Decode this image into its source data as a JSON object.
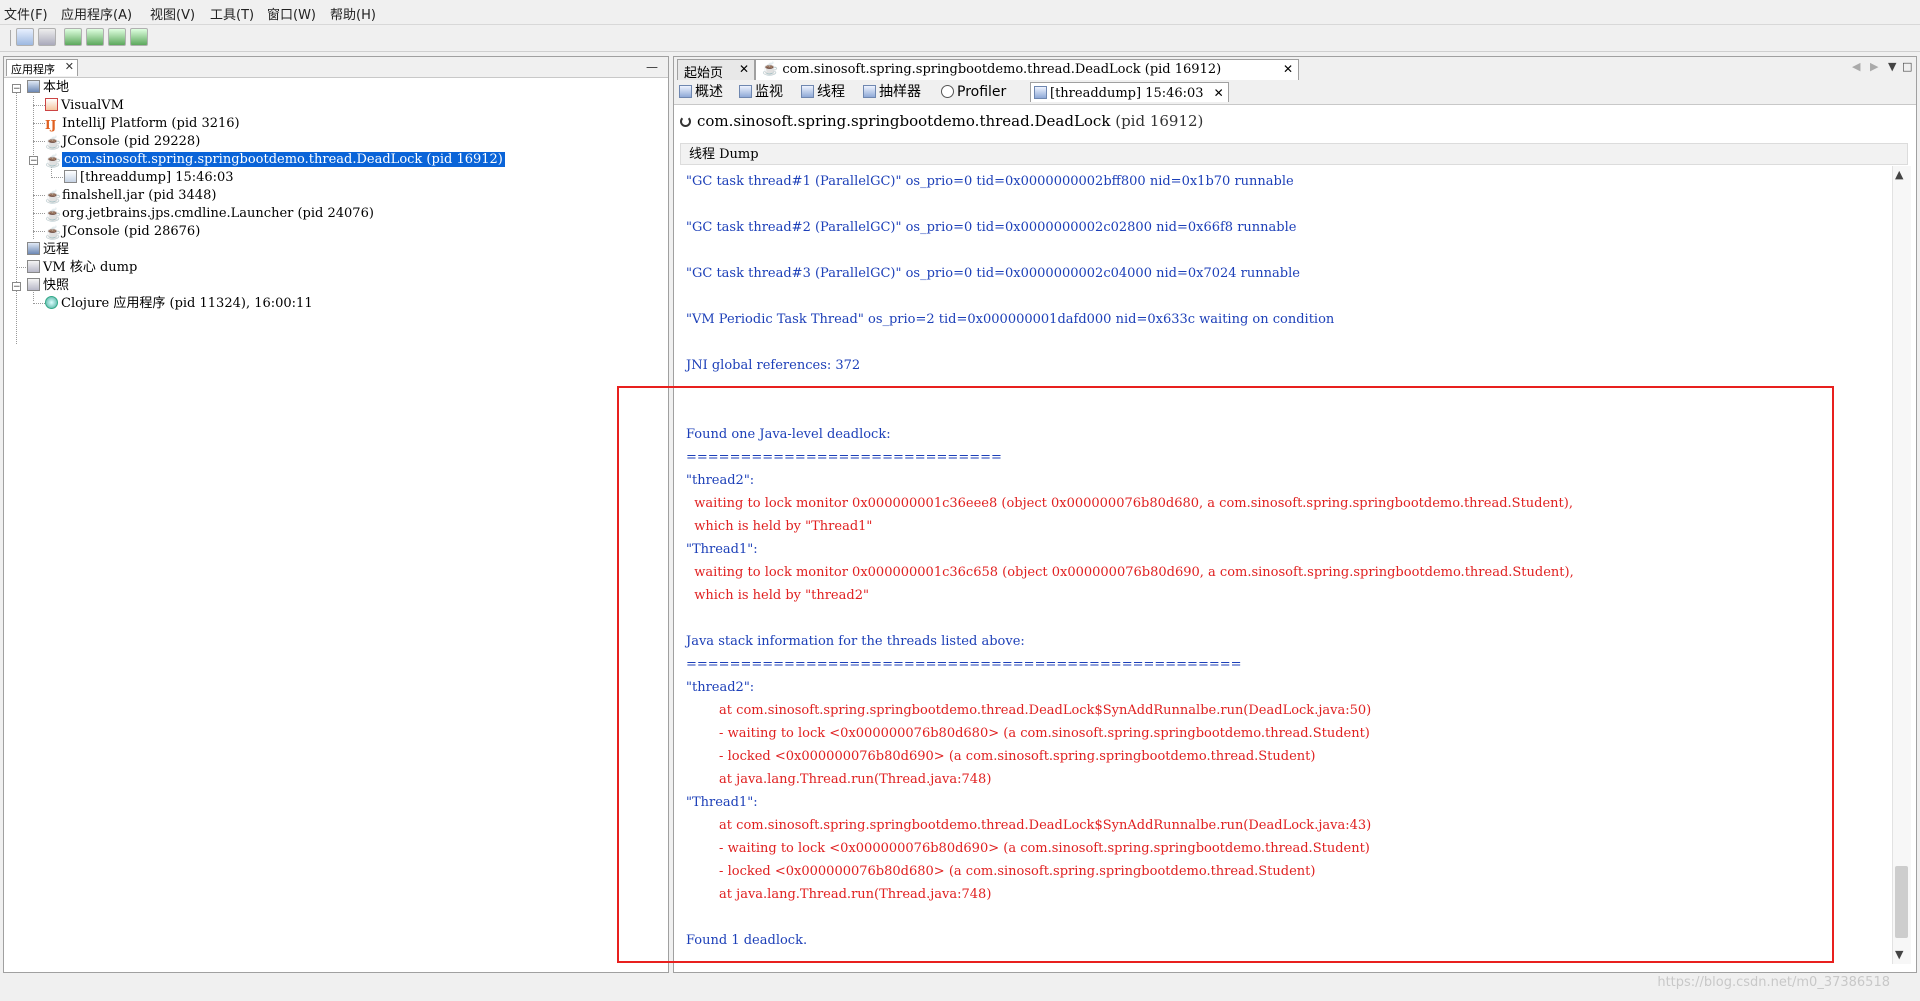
{
  "menu": [
    "文件(F)",
    "应用程序(A)",
    "视图(V)",
    "工具(T)",
    "窗口(W)",
    "帮助(H)"
  ],
  "left_panel": {
    "tab_label": "应用程序",
    "tree": {
      "local": "本地",
      "local_items": [
        "VisualVM",
        "IntelliJ Platform (pid 3216)",
        "JConsole (pid 29228)",
        "com.sinosoft.spring.springbootdemo.thread.DeadLock (pid 16912)",
        "[threaddump] 15:46:03",
        "finalshell.jar (pid 3448)",
        "org.jetbrains.jps.cmdline.Launcher (pid 24076)",
        "JConsole (pid 28676)"
      ],
      "remote": "远程",
      "core_dump": "VM 核心 dump",
      "snapshots": "快照",
      "snapshot_item": "Clojure 应用程序 (pid 11324), 16:00:11"
    }
  },
  "right_panel": {
    "tabs": [
      "起始页",
      "com.sinosoft.spring.springbootdemo.thread.DeadLock (pid 16912)"
    ],
    "subtabs": [
      "概述",
      "监视",
      "线程",
      "抽样器",
      "Profiler",
      "[threaddump] 15:46:03"
    ],
    "title": "com.sinosoft.spring.springbootdemo.thread.DeadLock",
    "title_pid": "(pid 16912)",
    "dump_header": "线程 Dump",
    "dump_lines": [
      {
        "text": "\"GC task thread#1 (ParallelGC)\" os_prio=0 tid=0x0000000002bff800 nid=0x1b70 runnable",
        "color": "blue"
      },
      {
        "text": "\"GC task thread#2 (ParallelGC)\" os_prio=0 tid=0x0000000002c02800 nid=0x66f8 runnable",
        "color": "blue"
      },
      {
        "text": "\"GC task thread#3 (ParallelGC)\" os_prio=0 tid=0x0000000002c04000 nid=0x7024 runnable",
        "color": "blue"
      },
      {
        "text": "\"VM Periodic Task Thread\" os_prio=2 tid=0x000000001dafd000 nid=0x633c waiting on condition",
        "color": "blue"
      },
      {
        "text": "JNI global references: 372",
        "color": "blue"
      },
      {
        "text": "Found one Java-level deadlock:",
        "color": "blue"
      },
      {
        "text": "=============================",
        "color": "blue"
      },
      {
        "text": "\"thread2\":",
        "color": "blue"
      },
      {
        "text": "  waiting to lock monitor 0x000000001c36eee8 (object 0x000000076b80d680, a com.sinosoft.spring.springbootdemo.thread.Student),",
        "color": "red"
      },
      {
        "text": "  which is held by \"Thread1\"",
        "color": "red"
      },
      {
        "text": "\"Thread1\":",
        "color": "blue"
      },
      {
        "text": "  waiting to lock monitor 0x000000001c36c658 (object 0x000000076b80d690, a com.sinosoft.spring.springbootdemo.thread.Student),",
        "color": "red"
      },
      {
        "text": "  which is held by \"thread2\"",
        "color": "red"
      },
      {
        "text": "Java stack information for the threads listed above:",
        "color": "blue"
      },
      {
        "text": "===================================================",
        "color": "blue"
      },
      {
        "text": "\"thread2\":",
        "color": "blue"
      },
      {
        "text": "        at com.sinosoft.spring.springbootdemo.thread.DeadLock$SynAddRunnalbe.run(DeadLock.java:50)",
        "color": "red"
      },
      {
        "text": "        - waiting to lock <0x000000076b80d680> (a com.sinosoft.spring.springbootdemo.thread.Student)",
        "color": "red"
      },
      {
        "text": "        - locked <0x000000076b80d690> (a com.sinosoft.spring.springbootdemo.thread.Student)",
        "color": "red"
      },
      {
        "text": "        at java.lang.Thread.run(Thread.java:748)",
        "color": "red"
      },
      {
        "text": "\"Thread1\":",
        "color": "blue"
      },
      {
        "text": "        at com.sinosoft.spring.springbootdemo.thread.DeadLock$SynAddRunnalbe.run(DeadLock.java:43)",
        "color": "red"
      },
      {
        "text": "        - waiting to lock <0x000000076b80d690> (a com.sinosoft.spring.springbootdemo.thread.Student)",
        "color": "red"
      },
      {
        "text": "        - locked <0x000000076b80d680> (a com.sinosoft.spring.springbootdemo.thread.Student)",
        "color": "red"
      },
      {
        "text": "        at java.lang.Thread.run(Thread.java:748)",
        "color": "red"
      },
      {
        "text": "Found 1 deadlock.",
        "color": "blue"
      }
    ]
  },
  "watermark": "https://blog.csdn.net/m0_37386518",
  "colors": {
    "selection": "#0a64d8",
    "dump_blue": "#1c3fb8",
    "dump_red": "#e02020",
    "highlight_box": "#e8201e"
  }
}
